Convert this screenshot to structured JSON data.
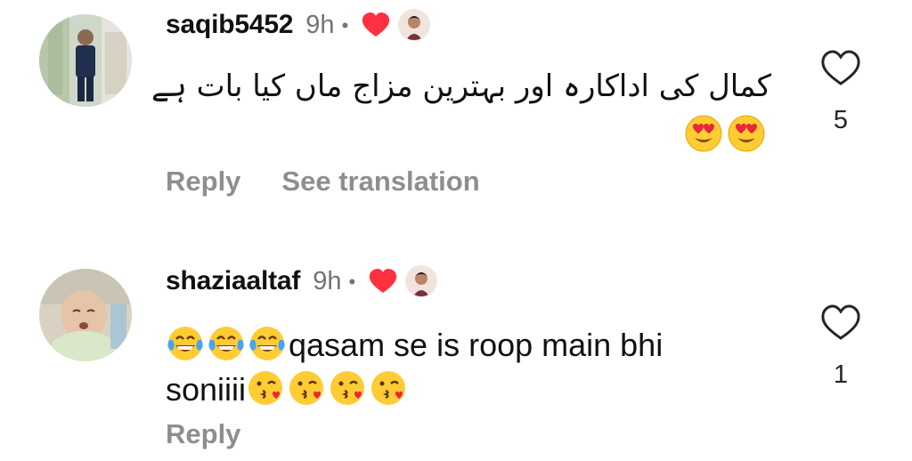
{
  "comments": [
    {
      "username": "saqib5452",
      "time": "9h",
      "dot": "•",
      "text_lines": [
        "کمال کی اداکارہ اور بہترین مزاج ماں کیا بات ہے"
      ],
      "emojis": [
        "heart-eyes",
        "heart-eyes"
      ],
      "actions": {
        "reply": "Reply",
        "translate": "See translation"
      },
      "like_count": "5",
      "liked_by_author": true
    },
    {
      "username": "shaziaaltaf",
      "time": "9h",
      "dot": "•",
      "text_line1": "qasam se is roop main bhi",
      "text_line2": "soniiii",
      "leading_emojis": [
        "tears-of-joy",
        "tears-of-joy",
        "tears-of-joy"
      ],
      "trailing_emojis": [
        "kiss",
        "kiss",
        "kiss",
        "kiss"
      ],
      "actions": {
        "reply": "Reply"
      },
      "like_count": "1",
      "liked_by_author": true
    }
  ],
  "colors": {
    "heart_red": "#ff3040",
    "muted": "#8e8e8e",
    "time_gray": "#737373"
  }
}
